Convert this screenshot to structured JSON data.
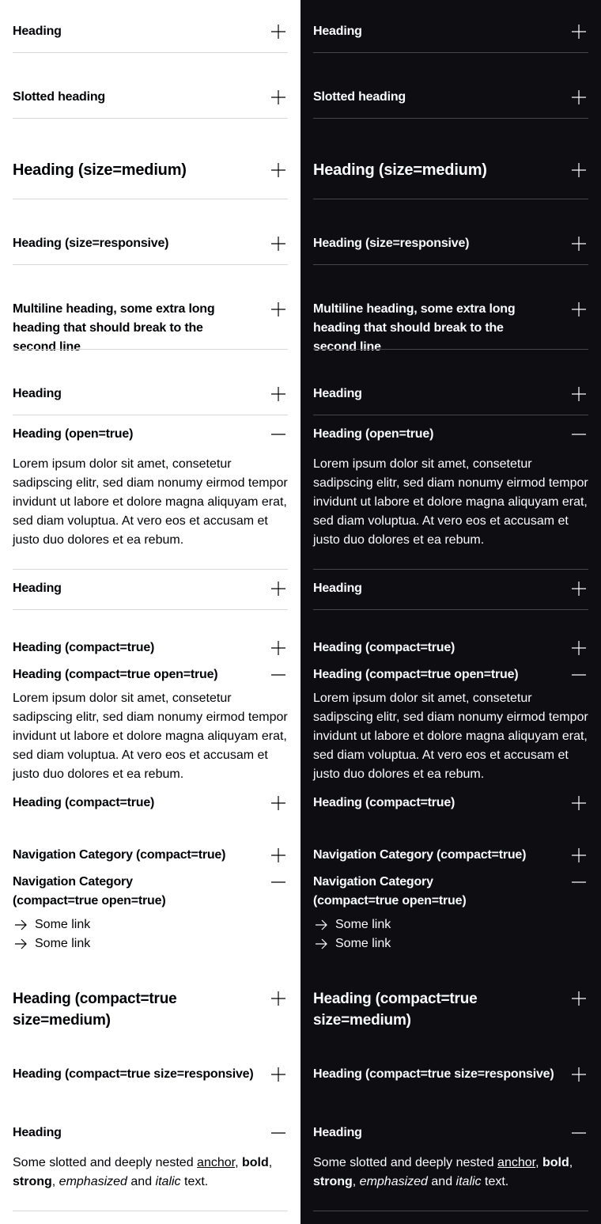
{
  "accordions": {
    "heading": "Heading",
    "slotted_heading": "Slotted heading",
    "medium_heading": "Heading (size=medium)",
    "responsive_heading": "Heading (size=responsive)",
    "multiline_heading": "Multiline heading, some extra long heading that should break to the second line",
    "heading_2": "Heading",
    "open_heading": "Heading (open=true)",
    "open_content": "Lorem ipsum dolor sit amet, consetetur sadipscing elitr, sed diam nonumy eirmod tempor invidunt ut labore et dolore magna aliquyam erat, sed diam voluptua. At vero eos et accusam et justo duo dolores et ea rebum.",
    "heading_3": "Heading",
    "compact_heading": "Heading (compact=true)",
    "compact_open_heading": "Heading (compact=true open=true)",
    "compact_open_content": "Lorem ipsum dolor sit amet, consetetur sadipscing elitr, sed diam nonumy eirmod tempor invidunt ut labore et dolore magna aliquyam erat, sed diam voluptua. At vero eos et accusam et justo duo dolores et ea rebum.",
    "compact_heading_2": "Heading (compact=true)",
    "nav_category": "Navigation Category (compact=true)",
    "nav_category_open": "Navigation Category (compact=true open=true)",
    "links": [
      "Some link",
      "Some link"
    ],
    "compact_medium_heading": "Heading (compact=true size=medium)",
    "compact_responsive_heading": "Heading (compact=true size=responsive)",
    "last_heading": "Heading",
    "slotted": {
      "prefix": "Some slotted and deeply nested ",
      "anchor": "anchor",
      "comma1": ", ",
      "bold": "bold",
      "comma2": ", ",
      "strong": "strong",
      "comma3": ", ",
      "emphasized": "emphasized",
      "and": " and ",
      "italic": "italic",
      "suffix": " text."
    }
  },
  "themes": {
    "light": {
      "background": "#ffffff",
      "text": "#010205"
    },
    "dark": {
      "background": "#0e0e12",
      "text": "#fbfcff"
    }
  },
  "icons": {
    "collapsed": "plus-icon",
    "expanded": "minus-icon",
    "link": "arrow-right-icon"
  }
}
